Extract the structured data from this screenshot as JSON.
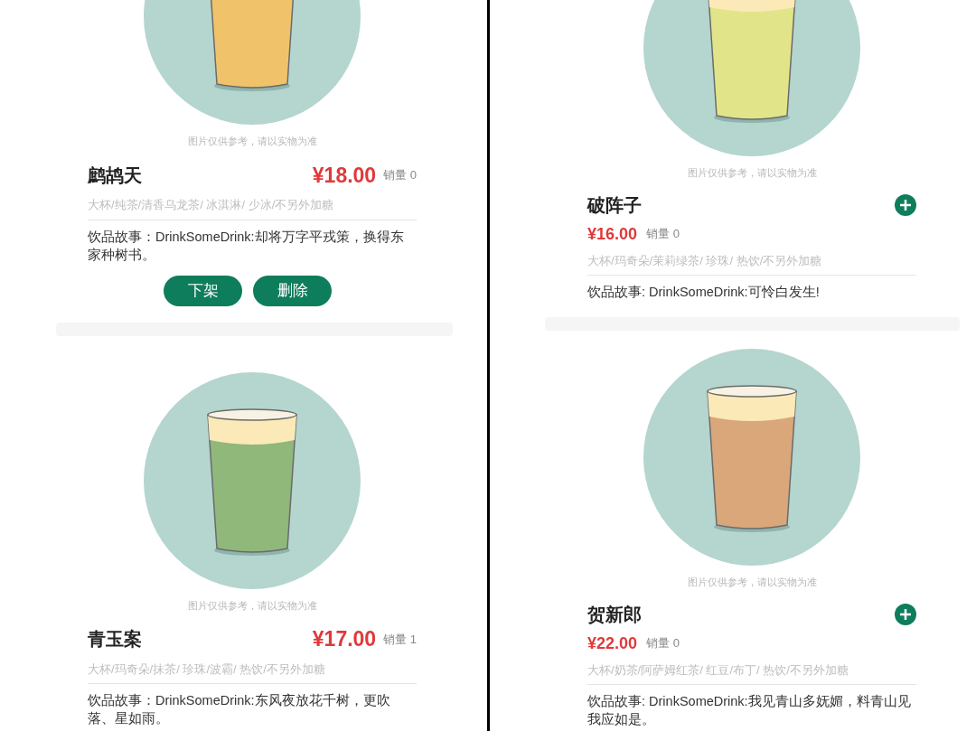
{
  "panels": [
    {
      "kind": "manage",
      "items": [
        {
          "image_note": "图片仅供参考，请以实物为准",
          "name": "鹧鸪天",
          "price": "¥18.00",
          "sales": "销量 0",
          "specs": "大杯/纯茶/清香乌龙茶/ 冰淇淋/ 少冰/不另外加糖",
          "story": "饮品故事：DrinkSomeDrink:却将万字平戎策，换得东家种树书。",
          "color": "#f0c36a",
          "actions": [
            "下架",
            "删除"
          ]
        },
        {
          "image_note": "图片仅供参考，请以实物为准",
          "name": "青玉案",
          "price": "¥17.00",
          "sales": "销量 1",
          "specs": "大杯/玛奇朵/抹茶/ 珍珠/波霸/ 热饮/不另外加糖",
          "story": "饮品故事：DrinkSomeDrink:东风夜放花千树，更吹落、星如雨。",
          "color": "#8fb87a"
        }
      ]
    },
    {
      "kind": "order",
      "items": [
        {
          "image_note": "图片仅供参考，请以实物为准",
          "name": "破阵子",
          "price": "¥16.00",
          "sales": "销量 0",
          "specs": "大杯/玛奇朵/茉莉绿茶/ 珍珠/ 热饮/不另外加糖",
          "story": "饮品故事: DrinkSomeDrink:可怜白发生!",
          "color": "#e2e48a"
        },
        {
          "image_note": "图片仅供参考，请以实物为准",
          "name": "贺新郎",
          "price": "¥22.00",
          "sales": "销量 0",
          "specs": "大杯/奶茶/阿萨姆红茶/ 红豆/布丁/ 热饮/不另外加糖",
          "story": "饮品故事: DrinkSomeDrink:我见青山多妩媚，料青山见我应如是。",
          "color": "#d9a77a"
        }
      ]
    }
  ]
}
